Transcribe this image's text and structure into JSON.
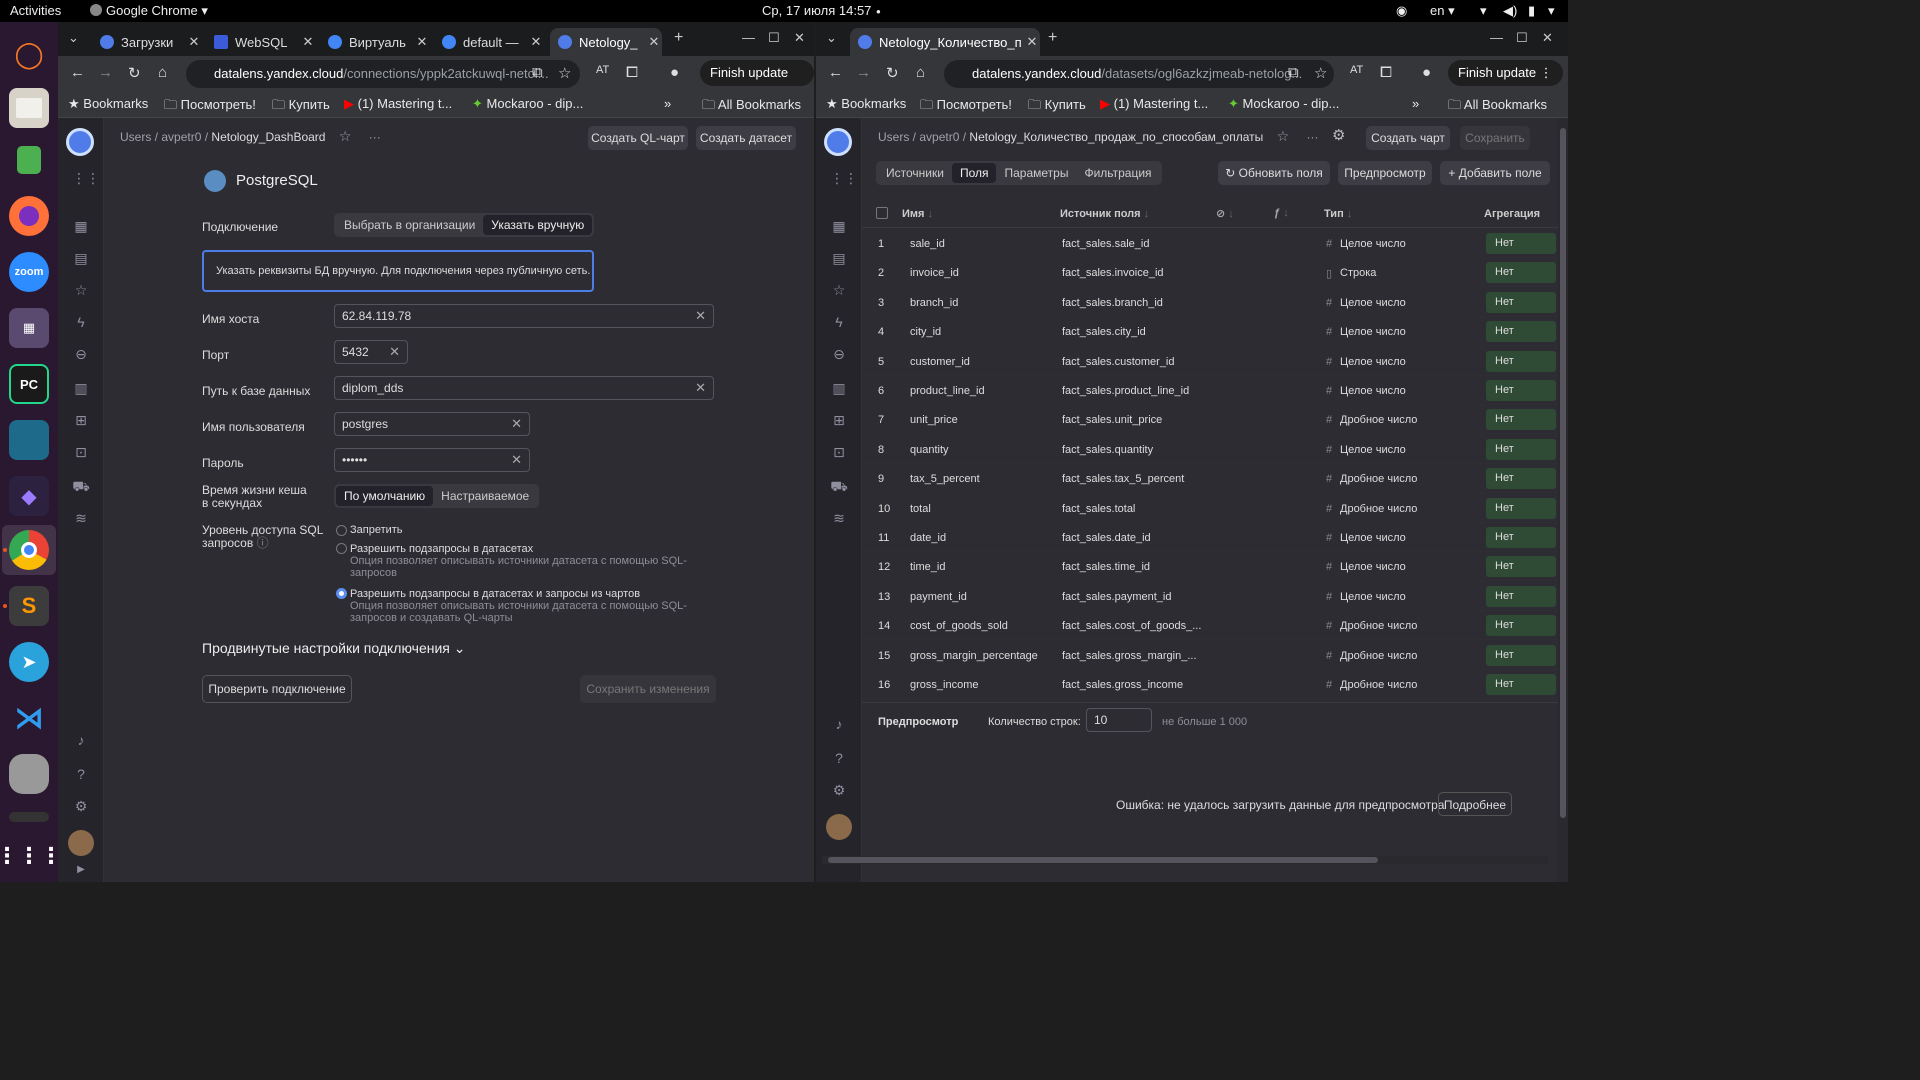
{
  "system": {
    "activities": "Activities",
    "app_menu": "Google Chrome",
    "datetime": "Ср, 17 июля  14:57",
    "lang": "en"
  },
  "dock": {
    "apps": [
      "jupyter",
      "files",
      "vpn",
      "firefox",
      "zoom",
      "media",
      "pycharm",
      "panel",
      "obsidian",
      "chrome",
      "sublime",
      "telegram",
      "vscode",
      "database",
      "terminal",
      "grid"
    ]
  },
  "left_window": {
    "tabs": [
      "Загрузки",
      "WebSQL",
      "Виртуаль",
      "default —",
      "Netology_"
    ],
    "url_main": "datalens.yandex.cloud",
    "url_rest": "/connections/yppk2atckuwql-netol...",
    "finish_update": "Finish update",
    "bookmarks": [
      "Bookmarks",
      "Посмотреть!",
      "Купить",
      "(1) Mastering t...",
      "Mockaroo - dip...",
      "All Bookmarks"
    ],
    "breadcrumb": {
      "p1": "Users",
      "p2": "avpetr0",
      "cur": "Netology_DashBoard"
    },
    "actions": {
      "ql": "Создать QL-чарт",
      "dataset": "Создать датасет"
    },
    "db_title": "PostgreSQL",
    "connection": {
      "label": "Подключение",
      "opt1": "Выбрать в организации",
      "opt2": "Указать вручную"
    },
    "info": "Указать реквизиты БД вручную. Для подключения через публичную сеть.",
    "host": {
      "label": "Имя хоста",
      "value": "62.84.119.78"
    },
    "port": {
      "label": "Порт",
      "value": "5432"
    },
    "db_path": {
      "label": "Путь к базе данных",
      "value": "diplom_dds"
    },
    "user": {
      "label": "Имя пользователя",
      "value": "postgres"
    },
    "password": {
      "label": "Пароль",
      "value": "••••••"
    },
    "cache": {
      "label1": "Время жизни кеша",
      "label2": "в секундах",
      "opt1": "По умолчанию",
      "opt2": "Настраиваемое"
    },
    "sql_level": {
      "label1": "Уровень доступа SQL",
      "label2": "запросов",
      "r1": "Запретить",
      "r2": "Разрешить подзапросы в датасетах",
      "r2h": "Опция позволяет описывать источники датасета с помощью SQL-запросов",
      "r3": "Разрешить подзапросы в датасетах и запросы из чартов",
      "r3h": "Опция позволяет описывать источники датасета с помощью SQL-запросов и создавать QL-чарты"
    },
    "advanced": "Продвинутые настройки подключения",
    "check_btn": "Проверить подключение",
    "save_btn": "Сохранить изменения"
  },
  "right_window": {
    "tab": "Netology_Количество_п",
    "url_main": "datalens.yandex.cloud",
    "url_rest": "/datasets/ogl6azkzjmeab-netolog...",
    "finish_update": "Finish update",
    "bookmarks": [
      "Bookmarks",
      "Посмотреть!",
      "Купить",
      "(1) Mastering t...",
      "Mockaroo - dip...",
      "All Bookmarks"
    ],
    "breadcrumb": {
      "p1": "Users",
      "p2": "avpetr0",
      "cur": "Netology_Количество_продаж_по_способам_оплаты"
    },
    "actions": {
      "chart": "Создать чарт",
      "save": "Сохранить"
    },
    "tabs": [
      "Источники",
      "Поля",
      "Параметры",
      "Фильтрация"
    ],
    "tools": {
      "refresh": "Обновить поля",
      "preview": "Предпросмотр",
      "add": "Добавить поле"
    },
    "columns": {
      "name": "Имя",
      "source": "Источник поля",
      "type": "Тип",
      "agg": "Агрегация"
    },
    "rows": [
      {
        "n": "1",
        "name": "sale_id",
        "src": "fact_sales.sale_id",
        "type": "Целое число",
        "agg": "Нет"
      },
      {
        "n": "2",
        "name": "invoice_id",
        "src": "fact_sales.invoice_id",
        "type": "Строка",
        "agg": "Нет"
      },
      {
        "n": "3",
        "name": "branch_id",
        "src": "fact_sales.branch_id",
        "type": "Целое число",
        "agg": "Нет"
      },
      {
        "n": "4",
        "name": "city_id",
        "src": "fact_sales.city_id",
        "type": "Целое число",
        "agg": "Нет"
      },
      {
        "n": "5",
        "name": "customer_id",
        "src": "fact_sales.customer_id",
        "type": "Целое число",
        "agg": "Нет"
      },
      {
        "n": "6",
        "name": "product_line_id",
        "src": "fact_sales.product_line_id",
        "type": "Целое число",
        "agg": "Нет"
      },
      {
        "n": "7",
        "name": "unit_price",
        "src": "fact_sales.unit_price",
        "type": "Дробное число",
        "agg": "Нет"
      },
      {
        "n": "8",
        "name": "quantity",
        "src": "fact_sales.quantity",
        "type": "Целое число",
        "agg": "Нет"
      },
      {
        "n": "9",
        "name": "tax_5_percent",
        "src": "fact_sales.tax_5_percent",
        "type": "Дробное число",
        "agg": "Нет"
      },
      {
        "n": "10",
        "name": "total",
        "src": "fact_sales.total",
        "type": "Дробное число",
        "agg": "Нет"
      },
      {
        "n": "11",
        "name": "date_id",
        "src": "fact_sales.date_id",
        "type": "Целое число",
        "agg": "Нет"
      },
      {
        "n": "12",
        "name": "time_id",
        "src": "fact_sales.time_id",
        "type": "Целое число",
        "agg": "Нет"
      },
      {
        "n": "13",
        "name": "payment_id",
        "src": "fact_sales.payment_id",
        "type": "Целое число",
        "agg": "Нет"
      },
      {
        "n": "14",
        "name": "cost_of_goods_sold",
        "src": "fact_sales.cost_of_goods_...",
        "type": "Дробное число",
        "agg": "Нет"
      },
      {
        "n": "15",
        "name": "gross_margin_percentage",
        "src": "fact_sales.gross_margin_...",
        "type": "Дробное число",
        "agg": "Нет"
      },
      {
        "n": "16",
        "name": "gross_income",
        "src": "fact_sales.gross_income",
        "type": "Дробное число",
        "agg": "Нет"
      }
    ],
    "preview": {
      "title": "Предпросмотр",
      "rows_label": "Количество строк:",
      "rows_value": "10",
      "hint": "не больше 1 000",
      "error": "Ошибка: не удалось загрузить данные для предпросмотра",
      "details": "Подробнее"
    }
  }
}
